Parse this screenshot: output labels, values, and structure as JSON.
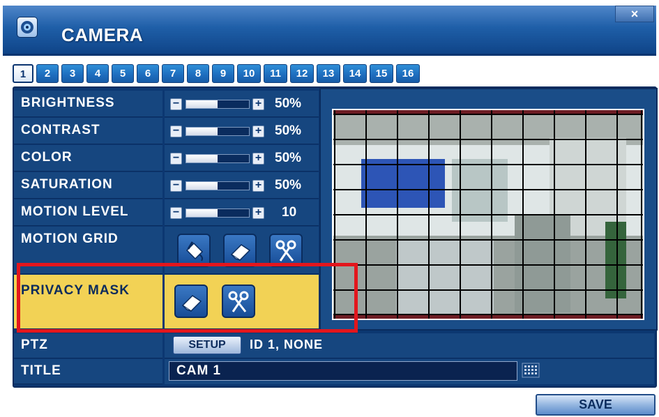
{
  "window": {
    "title": "CAMERA",
    "close_label": "×"
  },
  "channels": [
    "1",
    "2",
    "3",
    "4",
    "5",
    "6",
    "7",
    "8",
    "9",
    "10",
    "11",
    "12",
    "13",
    "14",
    "15",
    "16"
  ],
  "active_channel": "1",
  "settings": {
    "brightness": {
      "label": "BRIGHTNESS",
      "value": "50%",
      "level": 0.5
    },
    "contrast": {
      "label": "CONTRAST",
      "value": "50%",
      "level": 0.5
    },
    "color": {
      "label": "COLOR",
      "value": "50%",
      "level": 0.5
    },
    "saturation": {
      "label": "SATURATION",
      "value": "50%",
      "level": 0.5
    },
    "motion_level": {
      "label": "MOTION LEVEL",
      "value": "10",
      "level": 0.5
    }
  },
  "motion_grid": {
    "label": "MOTION GRID",
    "tools": [
      "paint-bucket-icon",
      "eraser-icon",
      "scissors-icon"
    ]
  },
  "privacy_mask": {
    "label": "PRIVACY MASK",
    "tools": [
      "eraser-icon",
      "scissors-icon"
    ],
    "highlight_color": "#f2d255"
  },
  "ptz": {
    "label": "PTZ",
    "setup_label": "SETUP",
    "info": "ID 1, NONE"
  },
  "title_row": {
    "label": "TITLE",
    "value": "CAM  1"
  },
  "save_label": "SAVE",
  "colors": {
    "panel": "#0c3771",
    "accent": "#1d6cbd",
    "annotation": "#e3161d"
  }
}
